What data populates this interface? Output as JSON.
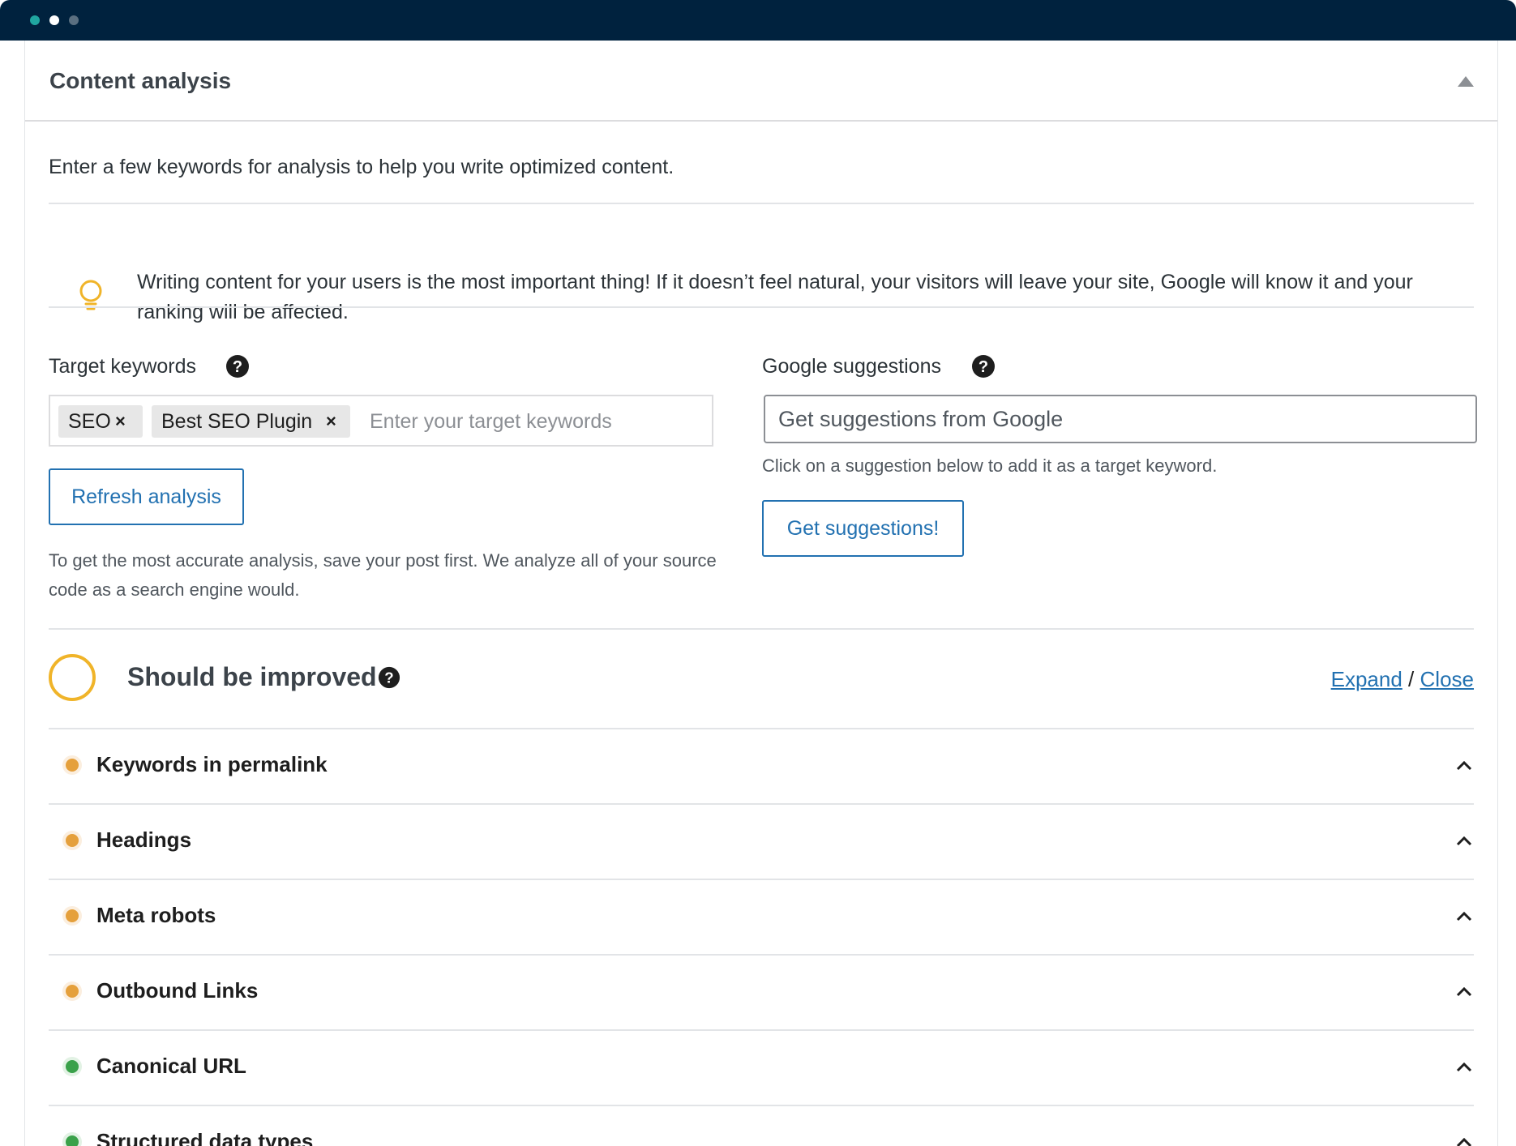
{
  "window": {
    "controls": [
      "close-dot",
      "minimize-dot",
      "zoom-dot"
    ]
  },
  "panel": {
    "title": "Content analysis",
    "intro": "Enter a few keywords for analysis to help you write optimized content.",
    "tip": "Writing content for your users is the most important thing! If it doesn’t feel natural, your visitors will leave your site, Google will know it and your ranking will be affected."
  },
  "target_keywords": {
    "label": "Target keywords",
    "tags": [
      "SEO",
      "Best SEO Plugin"
    ],
    "remove_symbol": "×",
    "placeholder": "Enter your target keywords",
    "refresh_button": "Refresh analysis",
    "note": "To get the most accurate analysis, save your post first. We analyze all of your source code as a search engine would."
  },
  "google_suggestions": {
    "label": "Google suggestions",
    "placeholder": "Get suggestions from Google",
    "hint": "Click on a suggestion below to add it as a target keyword.",
    "button": "Get suggestions!"
  },
  "analysis": {
    "status_title": "Should be improved",
    "expand_label": "Expand",
    "separator": "/",
    "close_label": "Close",
    "checks": [
      {
        "label": "Keywords in permalink",
        "status": "orange"
      },
      {
        "label": "Headings",
        "status": "orange"
      },
      {
        "label": "Meta robots",
        "status": "orange"
      },
      {
        "label": "Outbound Links",
        "status": "orange"
      },
      {
        "label": "Canonical URL",
        "status": "green"
      },
      {
        "label": "Structured data types",
        "status": "green"
      }
    ]
  },
  "colors": {
    "titlebar": "#00223e",
    "accent": "#2271b1",
    "warning": "#e5a03c",
    "good": "#3aa14a",
    "status_ring": "#f0b429"
  },
  "icons": [
    "lightbulb-icon",
    "help-icon",
    "chevron-up-icon",
    "caret-up-icon"
  ]
}
